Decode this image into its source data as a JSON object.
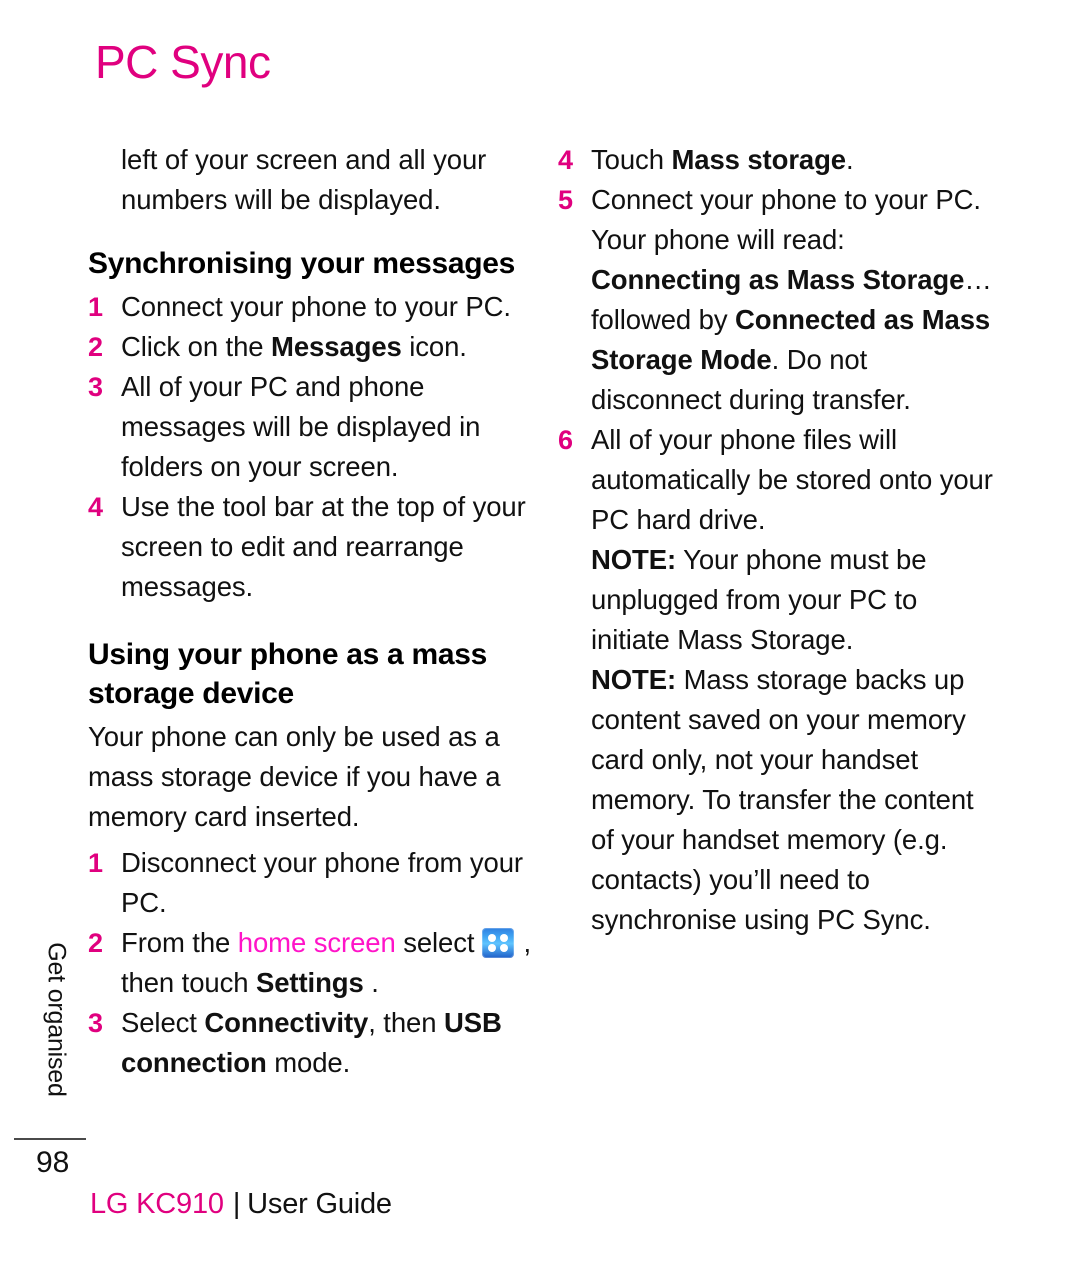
{
  "page": {
    "title": "PC Sync",
    "number": "98",
    "side_tab": "Get organised"
  },
  "colors": {
    "accent": "#e0007f",
    "accent_bright": "#ff14c8",
    "text": "#111111",
    "background": "#ffffff",
    "icon_blue": "#3fa3f2"
  },
  "left_column": {
    "intro_paragraph": {
      "line1": "left of your screen and all your",
      "line2": "numbers will be displayed."
    },
    "heading_1": "Synchronising your messages",
    "steps_1": [
      {
        "num": "1",
        "parts": [
          {
            "text": "Connect your phone to your PC.",
            "bold": false
          }
        ]
      },
      {
        "num": "2",
        "parts": [
          {
            "text": "Click on the ",
            "bold": false
          },
          {
            "text": "Messages",
            "bold": true
          },
          {
            "text": " icon.",
            "bold": false
          }
        ]
      },
      {
        "num": "3",
        "parts": [
          {
            "text": "All of your PC and phone messages will be displayed in folders on your screen.",
            "bold": false
          }
        ]
      },
      {
        "num": "4",
        "parts": [
          {
            "text": "Use the tool bar at the top of your screen to edit and rearrange messages.",
            "bold": false
          }
        ]
      }
    ],
    "heading_2": "Using your phone as a mass storage device",
    "body_paragraph": "Your phone can only be used as a mass storage device if you have a memory card inserted.",
    "steps_2": [
      {
        "num": "1",
        "parts": [
          {
            "text": "Disconnect your phone from your PC.",
            "bold": false
          }
        ]
      },
      {
        "num": "2",
        "parts": [
          {
            "text": "From the ",
            "bold": false
          },
          {
            "text": "home screen",
            "bold": false,
            "color": "accent_bright"
          },
          {
            "text": " select ",
            "bold": false
          },
          {
            "icon": "grid-apps-icon"
          },
          {
            "text": " , then touch ",
            "bold": false
          },
          {
            "text": "Settings",
            "bold": true
          },
          {
            "text": " .",
            "bold": false
          }
        ]
      },
      {
        "num": "3",
        "parts": [
          {
            "text": "Select ",
            "bold": false
          },
          {
            "text": "Connectivity",
            "bold": true
          },
          {
            "text": ", then ",
            "bold": false
          },
          {
            "text": "USB connection",
            "bold": true
          },
          {
            "text": " mode.",
            "bold": false
          }
        ]
      }
    ]
  },
  "right_column": {
    "steps": [
      {
        "num": "4",
        "parts": [
          {
            "text": "Touch ",
            "bold": false
          },
          {
            "text": "Mass storage",
            "bold": true
          },
          {
            "text": ".",
            "bold": false
          }
        ]
      },
      {
        "num": "5",
        "parts": [
          {
            "text": "Connect your phone to your PC. Your phone will read: ",
            "bold": false
          },
          {
            "text": "Connecting as Mass Storage",
            "bold": true
          },
          {
            "text": "… followed by ",
            "bold": false
          },
          {
            "text": "Connected as Mass Storage Mode",
            "bold": true
          },
          {
            "text": ". Do not disconnect during transfer.",
            "bold": false
          }
        ]
      },
      {
        "num": "6",
        "parts": [
          {
            "text": "All of your phone files will automatically be stored onto your PC hard drive.",
            "bold": false
          }
        ]
      }
    ],
    "notes": [
      {
        "label": "NOTE:",
        "text": " Your phone must be unplugged from your PC to initiate Mass Storage."
      },
      {
        "label": "NOTE:",
        "text": " Mass storage backs up content saved on your memory card only, not your handset memory. To transfer the content of your handset memory (e.g. contacts) you’ll need to synchronise using PC Sync."
      }
    ]
  },
  "footer": {
    "brand": "LG KC910",
    "separator": "|",
    "guide": "User Guide"
  }
}
